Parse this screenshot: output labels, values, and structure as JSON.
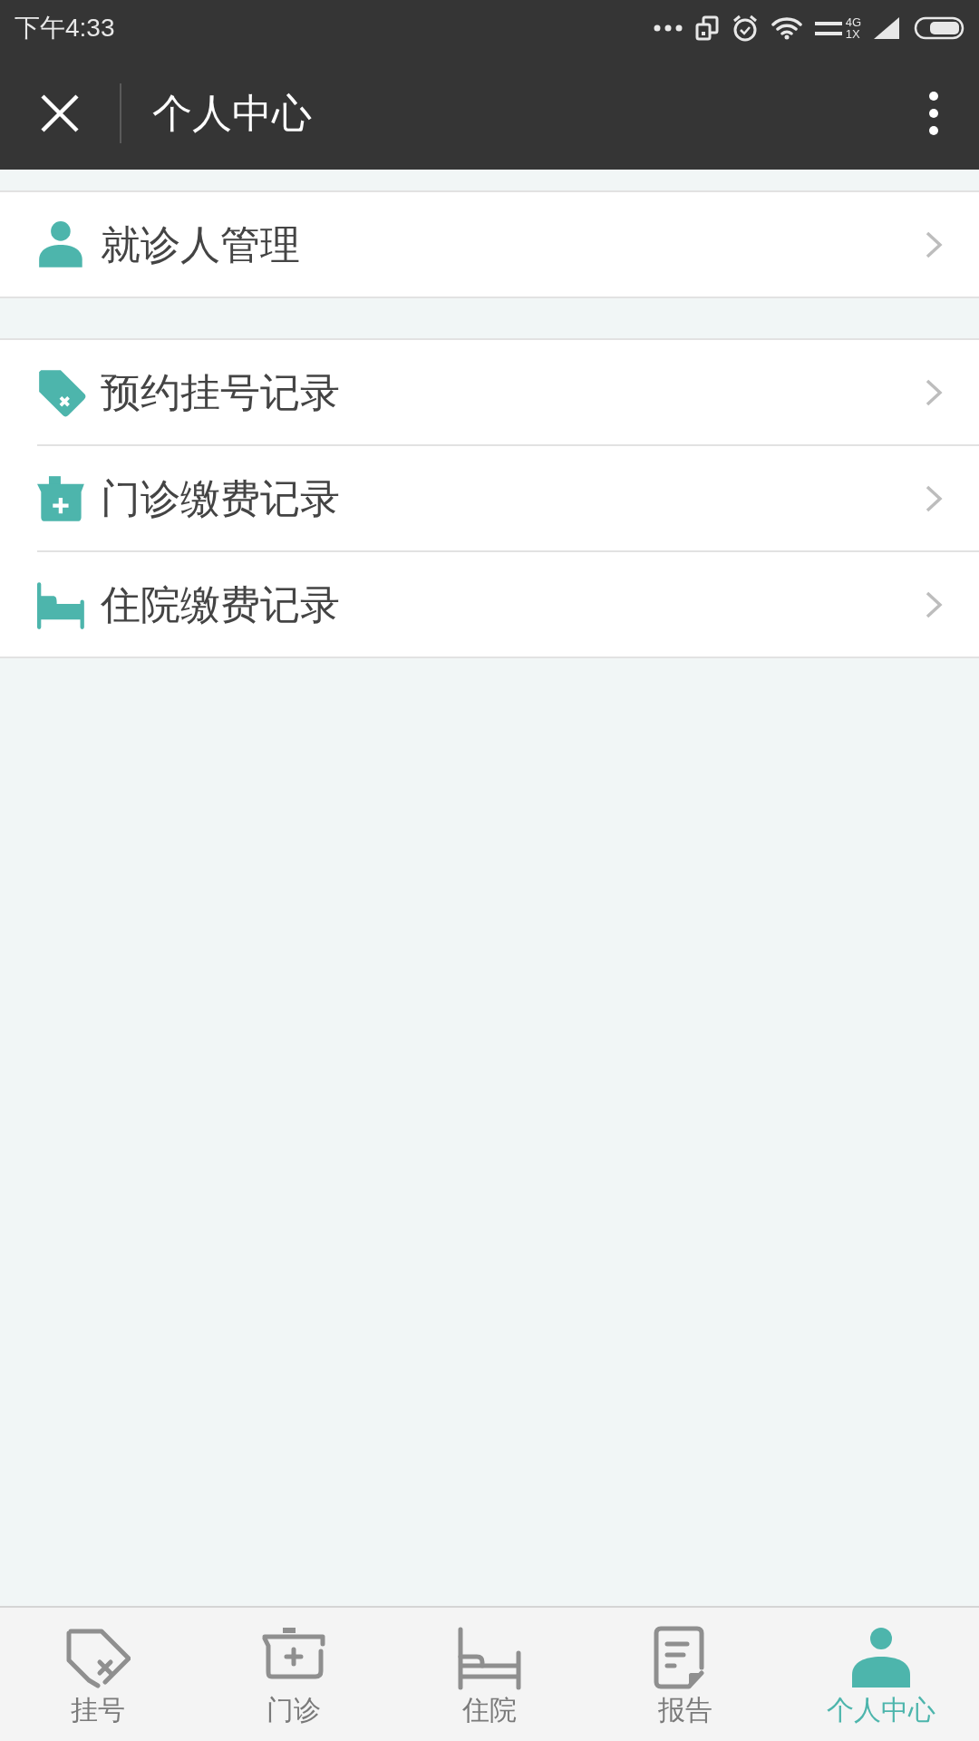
{
  "status_bar": {
    "time": "下午4:33",
    "network_top": "4G",
    "network_bottom": "1X"
  },
  "header": {
    "title": "个人中心"
  },
  "groups": [
    {
      "items": [
        {
          "label": "就诊人管理",
          "kind": "person"
        }
      ]
    },
    {
      "items": [
        {
          "label": "预约挂号记录",
          "kind": "tag"
        },
        {
          "label": "门诊缴费记录",
          "kind": "kit"
        },
        {
          "label": "住院缴费记录",
          "kind": "bed"
        }
      ]
    }
  ],
  "tabs": [
    {
      "label": "挂号",
      "kind": "tag",
      "selected": false
    },
    {
      "label": "门诊",
      "kind": "kit",
      "selected": false
    },
    {
      "label": "住院",
      "kind": "bed",
      "selected": false
    },
    {
      "label": "报告",
      "kind": "report",
      "selected": false
    },
    {
      "label": "个人中心",
      "kind": "person",
      "selected": true
    }
  ]
}
